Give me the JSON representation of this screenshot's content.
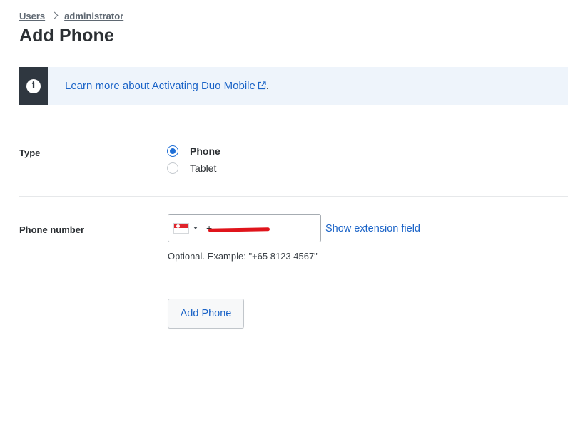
{
  "breadcrumb": {
    "items": [
      {
        "label": "Users"
      },
      {
        "label": "administrator"
      }
    ]
  },
  "page": {
    "title": "Add Phone"
  },
  "banner": {
    "icon": "info-icon",
    "link_text": "Learn more about Activating Duo Mobile",
    "trailing": "."
  },
  "form": {
    "type_label": "Type",
    "type_options": [
      {
        "label": "Phone",
        "checked": true
      },
      {
        "label": "Tablet",
        "checked": false
      }
    ],
    "phone_label": "Phone number",
    "phone_value": "+",
    "country_flag": "Singapore",
    "extension_link": "Show extension field",
    "hint": "Optional. Example: \"+65 8123 4567\"",
    "submit_label": "Add Phone"
  },
  "colors": {
    "link": "#1a63c7",
    "radio_accent": "#1f6fd6",
    "banner_bg": "#eef4fb",
    "banner_side": "#2f3740"
  }
}
